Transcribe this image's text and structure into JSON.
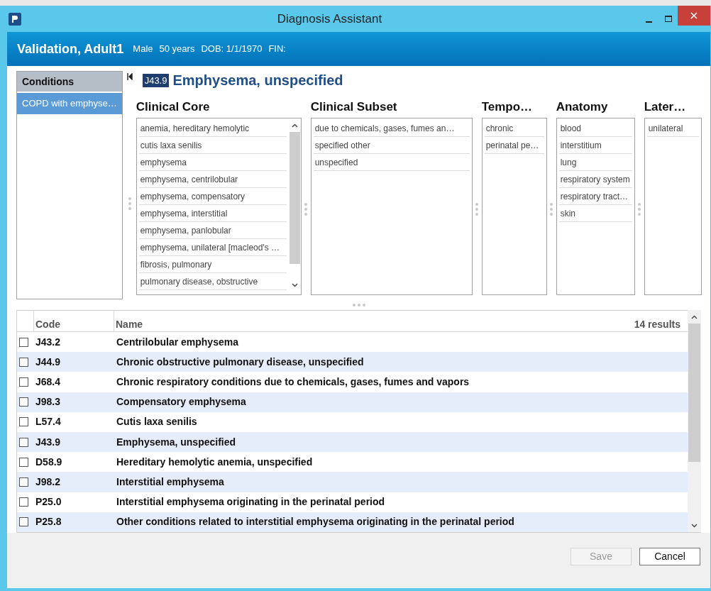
{
  "window": {
    "title": "Diagnosis Assistant"
  },
  "patient": {
    "name": "Validation, Adult1",
    "details": [
      "Male",
      "50 years",
      "DOB: 1/1/1970",
      "FIN:"
    ]
  },
  "conditions": {
    "header": "Conditions",
    "items": [
      {
        "label": "COPD with emphyse…",
        "selected": true
      }
    ]
  },
  "diagnosis": {
    "code": "J43.9",
    "title": "Emphysema, unspecified"
  },
  "facets": [
    {
      "title": "Clinical Core",
      "scrollable": true,
      "items": [
        "anemia, hereditary hemolytic",
        "cutis laxa senilis",
        "emphysema",
        "emphysema, centrilobular",
        "emphysema, compensatory",
        "emphysema, interstitial",
        "emphysema, panlobular",
        "emphysema, unilateral [macleod's …",
        "fibrosis, pulmonary",
        "pulmonary disease, obstructive"
      ]
    },
    {
      "title": "Clinical Subset",
      "scrollable": false,
      "items": [
        "due to chemicals, gases, fumes an…",
        "specified other",
        "unspecified"
      ]
    },
    {
      "title": "Tempo…",
      "scrollable": false,
      "items": [
        "chronic",
        "perinatal pe…"
      ]
    },
    {
      "title": "Anatomy",
      "scrollable": false,
      "items": [
        "blood",
        "interstitium",
        "lung",
        "respiratory system",
        "respiratory tract…",
        "skin"
      ]
    },
    {
      "title": "Later…",
      "scrollable": false,
      "items": [
        "unilateral"
      ]
    }
  ],
  "results": {
    "columns": [
      "Code",
      "Name"
    ],
    "count": "14 results",
    "rows": [
      {
        "code": "J43.2",
        "name": "Centrilobular emphysema",
        "checked": false
      },
      {
        "code": "J44.9",
        "name": "Chronic obstructive pulmonary disease, unspecified",
        "checked": false
      },
      {
        "code": "J68.4",
        "name": "Chronic respiratory conditions due to chemicals, gases, fumes and vapors",
        "checked": false
      },
      {
        "code": "J98.3",
        "name": "Compensatory emphysema",
        "checked": false
      },
      {
        "code": "L57.4",
        "name": "Cutis laxa senilis",
        "checked": false
      },
      {
        "code": "J43.9",
        "name": "Emphysema, unspecified",
        "checked": false
      },
      {
        "code": "D58.9",
        "name": "Hereditary hemolytic anemia, unspecified",
        "checked": false
      },
      {
        "code": "J98.2",
        "name": "Interstitial emphysema",
        "checked": false
      },
      {
        "code": "P25.0",
        "name": "Interstitial emphysema originating in the perinatal period",
        "checked": false
      },
      {
        "code": "P25.8",
        "name": "Other conditions related to interstitial emphysema originating in the perinatal period",
        "checked": false
      }
    ]
  },
  "buttons": [
    {
      "label": "Save",
      "disabled": true
    },
    {
      "label": "Cancel",
      "disabled": false
    }
  ]
}
